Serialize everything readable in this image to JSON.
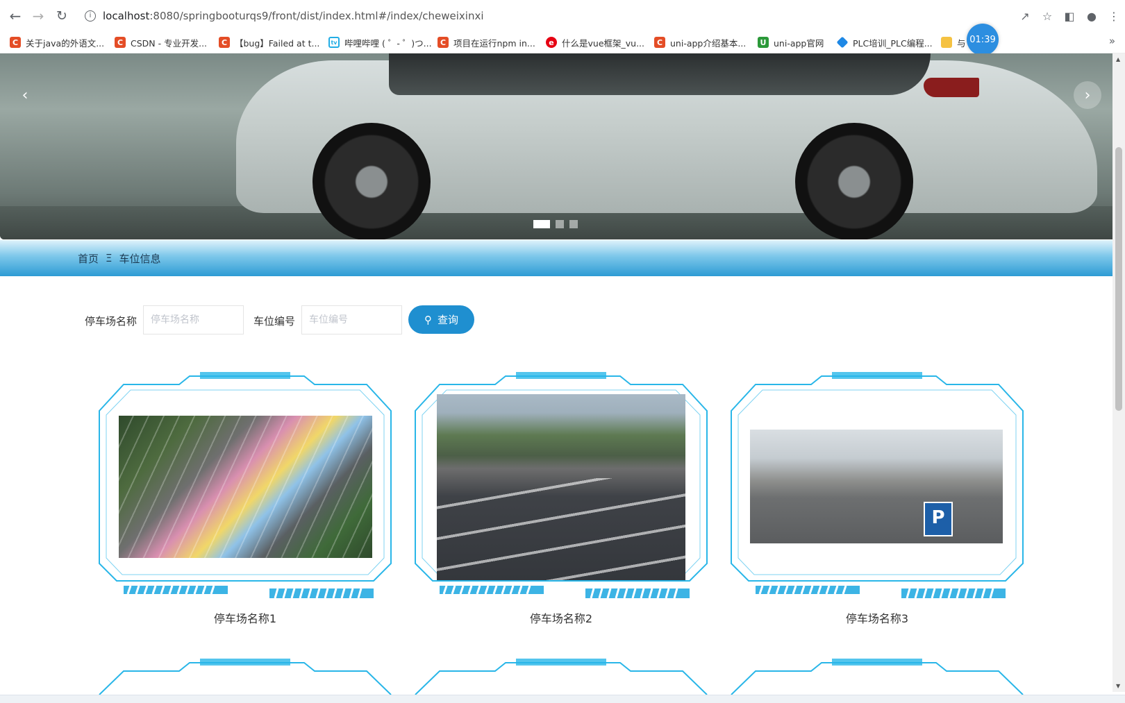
{
  "browser": {
    "url_host": "localhost",
    "url_rest": ":8080/springbooturqs9/front/dist/index.html#/index/cheweixinxi",
    "timer": "01:39",
    "bookmarks": [
      {
        "label": "关于java的外语文...",
        "icon": "csdn-icon"
      },
      {
        "label": "CSDN - 专业开发...",
        "icon": "csdn-icon"
      },
      {
        "label": "【bug】Failed at t...",
        "icon": "csdn-icon"
      },
      {
        "label": "哔哩哔哩 ( ゜- ゜)つ...",
        "icon": "bilibili-icon"
      },
      {
        "label": "项目在运行npm in...",
        "icon": "csdn-icon"
      },
      {
        "label": "什么是vue框架_vu...",
        "icon": "red-circle-icon"
      },
      {
        "label": "uni-app介绍基本...",
        "icon": "csdn-icon"
      },
      {
        "label": "uni-app官网",
        "icon": "uniapp-icon"
      },
      {
        "label": "PLC培训_PLC编程...",
        "icon": "diamond-icon"
      },
      {
        "label": "与",
        "icon": "misc-icon"
      }
    ]
  },
  "breadcrumb": {
    "home": "首页",
    "separator": "Ξ",
    "current": "车位信息"
  },
  "search": {
    "lot_label": "停车场名称",
    "lot_placeholder": "停车场名称",
    "spot_label": "车位编号",
    "spot_placeholder": "车位编号",
    "button_label": "查询"
  },
  "cards": [
    {
      "name": "停车场名称1"
    },
    {
      "name": "停车场名称2"
    },
    {
      "name": "停车场名称3"
    }
  ],
  "banner": {
    "slide_count": 3,
    "active_slide": 1
  },
  "colors": {
    "accent": "#1f8fd0",
    "frame": "#29b6e8"
  }
}
